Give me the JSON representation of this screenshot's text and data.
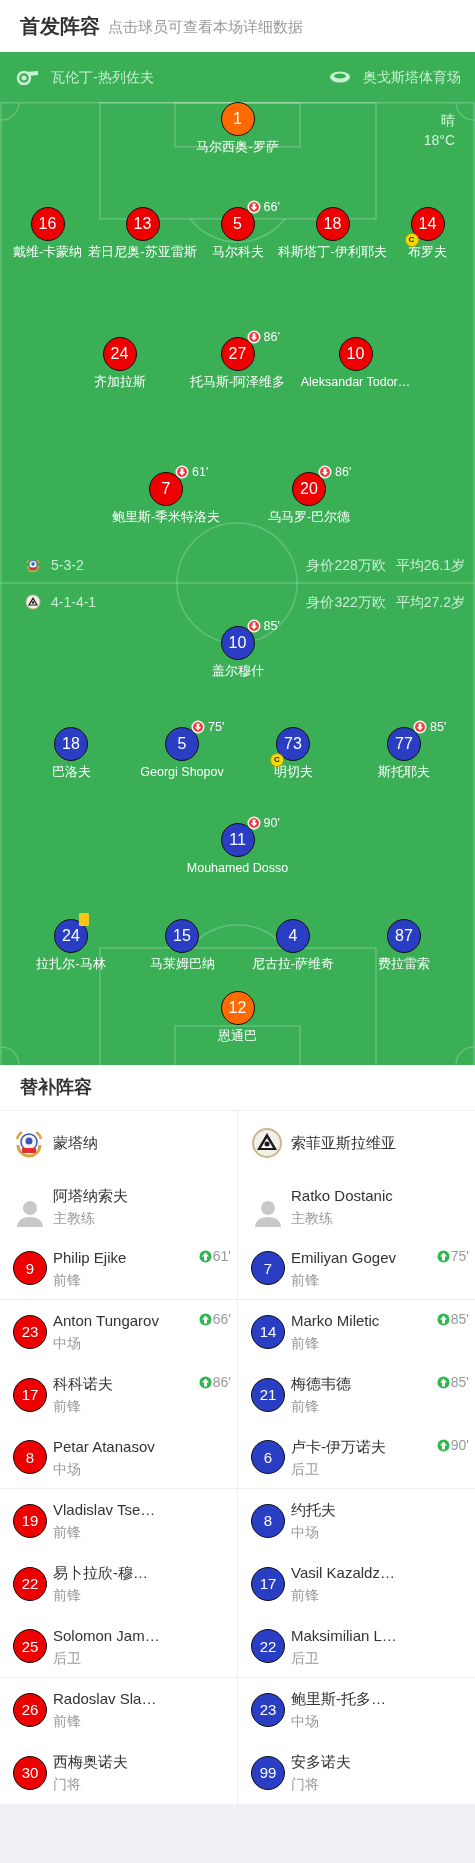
{
  "header": {
    "title": "首发阵容",
    "hint": "点击球员可查看本场详细数据"
  },
  "match_info": {
    "referee": "瓦伦丁-热列佐夫",
    "venue": "奥戈斯塔体育场",
    "weather": "晴",
    "temperature": "18°C"
  },
  "lineups": [
    {
      "color": "#ee0000",
      "formation": "5-3-2",
      "value": "身价228万欧",
      "avg_age": "平均26.1岁",
      "lines": [
        [
          {
            "number": "1",
            "name": "马尔西奥-罗萨",
            "kind": "goalkeeper",
            "yellow_card": false
          }
        ],
        [
          {
            "number": "16",
            "name": "戴维-卡蒙纳",
            "kind": "outfield",
            "yellow_card": false
          },
          {
            "number": "13",
            "name": "若日尼奥-苏亚雷斯",
            "kind": "outfield",
            "yellow_card": false
          },
          {
            "number": "5",
            "name": "马尔科夫",
            "kind": "outfield",
            "yellow_card": false,
            "sub_off": "66'"
          },
          {
            "number": "18",
            "name": "科斯塔丁-伊利耶夫",
            "kind": "outfield",
            "yellow_card": false
          },
          {
            "number": "14",
            "name": "布罗夫",
            "kind": "outfield",
            "yellow_card": false,
            "captain_badge": "C"
          }
        ],
        [
          {
            "number": "24",
            "name": "齐加拉斯",
            "kind": "outfield",
            "yellow_card": false
          },
          {
            "number": "27",
            "name": "托马斯-阿泽维多",
            "kind": "outfield",
            "yellow_card": false,
            "sub_off": "86'"
          },
          {
            "number": "10",
            "name": "Aleksandar Todor…",
            "kind": "outfield",
            "yellow_card": false
          }
        ],
        [
          {
            "number": "7",
            "name": "鲍里斯-季米特洛夫",
            "kind": "outfield",
            "yellow_card": false,
            "sub_off": "61'"
          },
          {
            "number": "20",
            "name": "乌马罗-巴尔德",
            "kind": "outfield",
            "yellow_card": false,
            "sub_off": "86'"
          }
        ]
      ]
    },
    {
      "color": "#2a3ec4",
      "formation": "4-1-4-1",
      "value": "身价322万欧",
      "avg_age": "平均27.2岁",
      "lines": [
        [
          {
            "number": "10",
            "name": "盖尔穆什",
            "kind": "outfield",
            "yellow_card": false,
            "sub_off": "85'"
          }
        ],
        [
          {
            "number": "18",
            "name": "巴洛夫",
            "kind": "outfield",
            "yellow_card": false
          },
          {
            "number": "5",
            "name": "Georgi Shopov",
            "kind": "outfield",
            "yellow_card": false,
            "sub_off": "75'"
          },
          {
            "number": "73",
            "name": "明切夫",
            "kind": "outfield",
            "yellow_card": false,
            "captain_badge": "C"
          },
          {
            "number": "77",
            "name": "斯托耶夫",
            "kind": "outfield",
            "yellow_card": false,
            "sub_off": "85'"
          }
        ],
        [
          {
            "number": "11",
            "name": "Mouhamed Dosso",
            "kind": "outfield",
            "yellow_card": false,
            "sub_off": "90'"
          }
        ],
        [
          {
            "number": "24",
            "name": "拉扎尔-马林",
            "kind": "outfield",
            "yellow_card": true
          },
          {
            "number": "15",
            "name": "马莱姆巴纳",
            "kind": "outfield",
            "yellow_card": false
          },
          {
            "number": "4",
            "name": "尼古拉-萨维奇",
            "kind": "outfield",
            "yellow_card": false
          },
          {
            "number": "87",
            "name": "费拉雷索",
            "kind": "outfield",
            "yellow_card": false
          }
        ],
        [
          {
            "number": "12",
            "name": "恩通巴",
            "kind": "goalkeeper",
            "yellow_card": false
          }
        ]
      ]
    }
  ],
  "bench": {
    "title": "替补阵容",
    "teams": [
      {
        "name": "蒙塔纳",
        "coach": {
          "name": "阿塔纳索夫",
          "role": "主教练"
        },
        "players": [
          {
            "number": "9",
            "name": "Philip Ejike",
            "position": "前锋",
            "sub_on": "61'",
            "divider_below": true
          },
          {
            "number": "23",
            "name": "Anton Tungarov",
            "position": "中场",
            "sub_on": "66'",
            "divider_below": false
          },
          {
            "number": "17",
            "name": "科科诺夫",
            "position": "前锋",
            "sub_on": "86'",
            "divider_below": false
          },
          {
            "number": "8",
            "name": "Petar Atanasov",
            "position": "中场",
            "divider_below": true
          },
          {
            "number": "19",
            "name": "Vladislav Tse…",
            "position": "前锋",
            "divider_below": false
          },
          {
            "number": "22",
            "name": "易卜拉欣-穆…",
            "position": "前锋",
            "divider_below": false
          },
          {
            "number": "25",
            "name": "Solomon Jam…",
            "position": "后卫",
            "divider_below": true
          },
          {
            "number": "26",
            "name": "Radoslav Sla…",
            "position": "前锋",
            "divider_below": false
          },
          {
            "number": "30",
            "name": "西梅奥诺夫",
            "position": "门将",
            "divider_below": false
          }
        ]
      },
      {
        "name": "索菲亚斯拉维亚",
        "coach": {
          "name": "Ratko Dostanic",
          "role": "主教练"
        },
        "players": [
          {
            "number": "7",
            "name": "Emiliyan Gogev",
            "position": "前锋",
            "sub_on": "75'",
            "divider_below": true
          },
          {
            "number": "14",
            "name": "Marko Miletic",
            "position": "前锋",
            "sub_on": "85'",
            "divider_below": false
          },
          {
            "number": "21",
            "name": "梅德韦德",
            "position": "前锋",
            "sub_on": "85'",
            "divider_below": false
          },
          {
            "number": "6",
            "name": "卢卡-伊万诺夫",
            "position": "后卫",
            "sub_on": "90'",
            "divider_below": true
          },
          {
            "number": "8",
            "name": "约托夫",
            "position": "中场",
            "divider_below": false
          },
          {
            "number": "17",
            "name": "Vasil Kazaldz…",
            "position": "前锋",
            "divider_below": false
          },
          {
            "number": "22",
            "name": "Maksimilian L…",
            "position": "后卫",
            "divider_below": true
          },
          {
            "number": "23",
            "name": "鲍里斯-托多…",
            "position": "中场",
            "divider_below": false
          },
          {
            "number": "99",
            "name": "安多诺夫",
            "position": "门将",
            "divider_below": false
          }
        ]
      }
    ]
  }
}
